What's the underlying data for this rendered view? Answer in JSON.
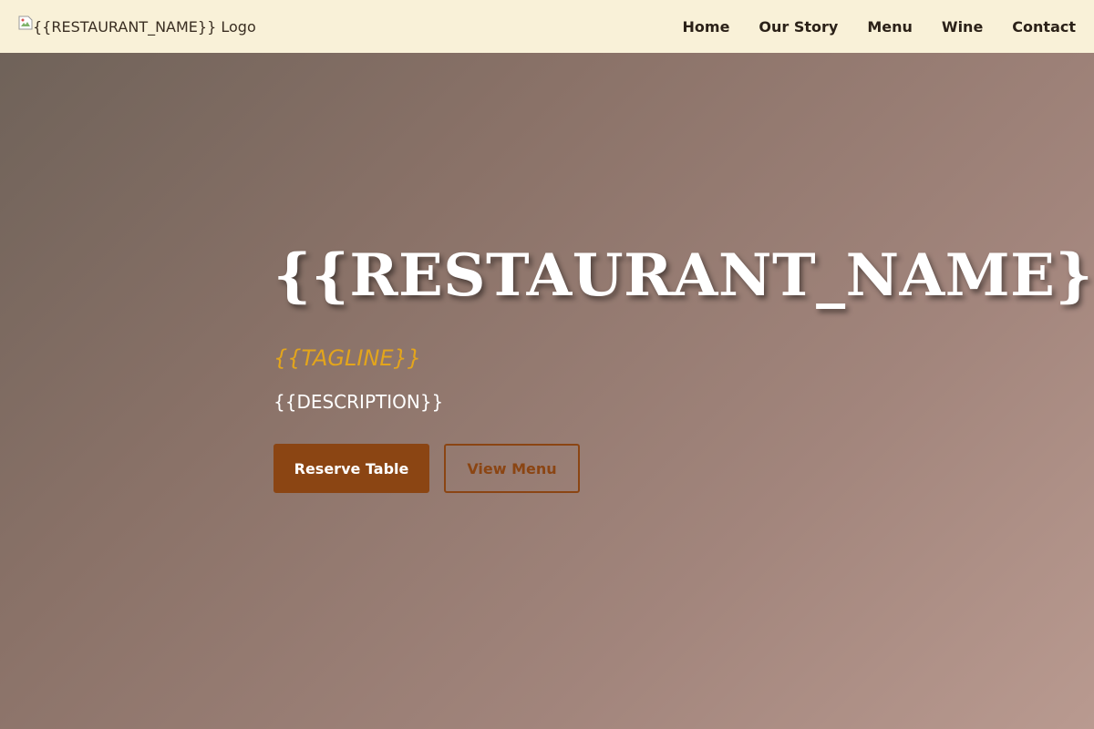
{
  "header": {
    "logo_alt": "{{RESTAURANT_NAME}} Logo",
    "nav": {
      "home": "Home",
      "our_story": "Our Story",
      "menu": "Menu",
      "wine": "Wine",
      "contact": "Contact"
    }
  },
  "hero": {
    "title": "{{RESTAURANT_NAME}}",
    "tagline": "{{TAGLINE}}",
    "description": "{{DESCRIPTION}}",
    "reserve_label": "Reserve Table",
    "view_menu_label": "View Menu"
  },
  "icons": {
    "logo": "broken-image-icon"
  },
  "colors": {
    "nav_background": "#f9f1d8",
    "accent": "#8b4513",
    "tagline": "#e3a51c",
    "hero_gradient_start": "#6d6158",
    "hero_gradient_end": "#b99a90"
  }
}
